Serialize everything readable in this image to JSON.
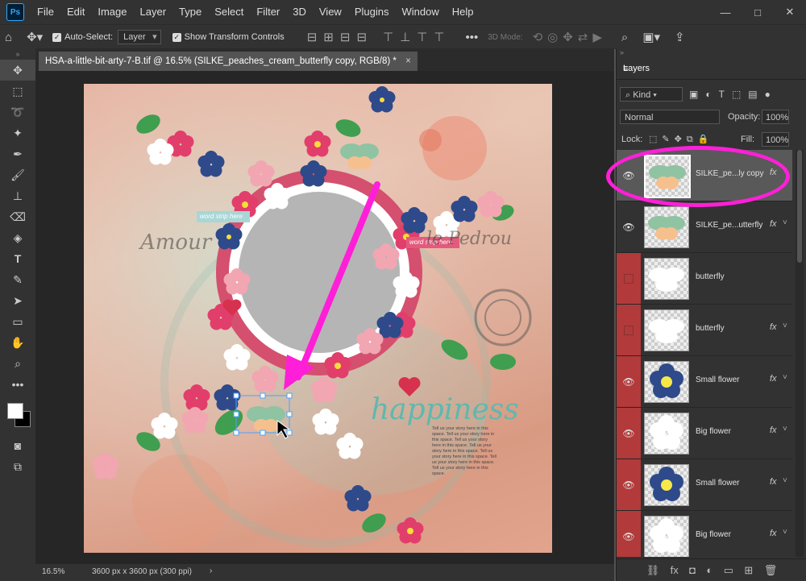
{
  "menu": {
    "logo": "Ps",
    "items": [
      "File",
      "Edit",
      "Image",
      "Layer",
      "Type",
      "Select",
      "Filter",
      "3D",
      "View",
      "Plugins",
      "Window",
      "Help"
    ]
  },
  "window": {
    "minimize": "—",
    "maximize": "□",
    "close": "✕"
  },
  "options": {
    "auto_select_label": "Auto-Select:",
    "auto_select_value": "Layer",
    "show_transform_label": "Show Transform Controls",
    "mode_3d_label": "3D Mode:"
  },
  "document": {
    "tab_title": "HSA-a-little-bit-arty-7-B.tif @ 16.5% (SILKE_peaches_cream_butterfly copy, RGB/8) *",
    "close": "×"
  },
  "artwork": {
    "word_strip_1": "word strip here",
    "word_strip_2": "word strip here",
    "script_left": "Amour",
    "script_right": "le Pedrou",
    "title": "happiness",
    "journal": "Tell us your story here in this space. Tell us your story here in this space. Tell us your story here in this space. Tell us your story here in this space. Tell us your story here in this space. Tell us your story here in this space. Tell us your story here in this space."
  },
  "status": {
    "zoom": "16.5%",
    "doc_size": "3600 px x 3600 px (300 ppi)",
    "arrow": "›"
  },
  "layers_panel": {
    "title": "Layers",
    "kind": "Kind",
    "blend_mode": "Normal",
    "opacity_label": "Opacity:",
    "opacity_value": "100%",
    "lock_label": "Lock:",
    "fill_label": "Fill:",
    "fill_value": "100%",
    "layers": [
      {
        "name": "SILKE_pe...ly copy",
        "visible": true,
        "selected": true,
        "fx": "fx",
        "thumb": "butterfly"
      },
      {
        "name": "SILKE_pe...utterfly",
        "visible": true,
        "selected": false,
        "fx": "fx",
        "thumb": "butterfly"
      },
      {
        "name": "butterfly",
        "visible": false,
        "selected": false,
        "fx": "",
        "thumb": "white"
      },
      {
        "name": "butterfly",
        "visible": false,
        "selected": false,
        "fx": "fx",
        "thumb": "white"
      },
      {
        "name": "Small flower",
        "visible": true,
        "selected": false,
        "fx": "fx",
        "thumb": "blue-flower"
      },
      {
        "name": "Big flower",
        "visible": true,
        "selected": false,
        "fx": "fx",
        "thumb": "white"
      },
      {
        "name": "Small flower",
        "visible": true,
        "selected": false,
        "fx": "fx",
        "thumb": "blue-flower"
      },
      {
        "name": "Big flower",
        "visible": true,
        "selected": false,
        "fx": "fx",
        "thumb": "white"
      }
    ]
  },
  "colors": {
    "highlight": "#ff1fd8",
    "visibility_red": "#b23a3a",
    "selected_row": "#595959"
  }
}
